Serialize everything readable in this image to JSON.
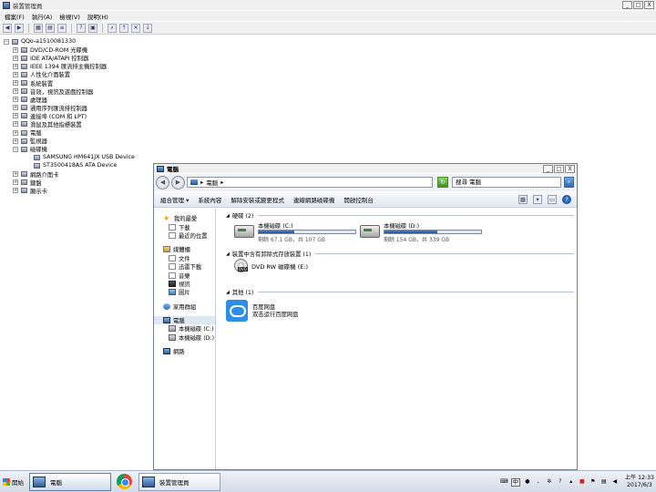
{
  "device_manager": {
    "title": "裝置管理員",
    "menu": [
      "檔案(F)",
      "執行(A)",
      "檢視(V)",
      "說明(H)"
    ],
    "tree": [
      {
        "label": "QQo-a1510081330",
        "level": 0,
        "exp": "−"
      },
      {
        "label": "DVD/CD-ROM 光碟機",
        "level": 1,
        "exp": "+"
      },
      {
        "label": "IDE ATA/ATAPI 控制器",
        "level": 1,
        "exp": "+"
      },
      {
        "label": "IEEE 1394 匯流排主機控制器",
        "level": 1,
        "exp": "+"
      },
      {
        "label": "人性化介面裝置",
        "level": 1,
        "exp": "+"
      },
      {
        "label": "系統裝置",
        "level": 1,
        "exp": "+"
      },
      {
        "label": "音效，視訊及遊戲控制器",
        "level": 1,
        "exp": "+"
      },
      {
        "label": "處理器",
        "level": 1,
        "exp": "+"
      },
      {
        "label": "通用序列匯流排控制器",
        "level": 1,
        "exp": "+"
      },
      {
        "label": "連接埠 (COM 和 LPT)",
        "level": 1,
        "exp": "+"
      },
      {
        "label": "滑鼠及其他指標裝置",
        "level": 1,
        "exp": "+"
      },
      {
        "label": "電腦",
        "level": 1,
        "exp": "+"
      },
      {
        "label": "監視器",
        "level": 1,
        "exp": "+"
      },
      {
        "label": "磁碟機",
        "level": 1,
        "exp": "−"
      },
      {
        "label": "SAMSUNG HM641JX USB Device",
        "level": 2,
        "exp": ""
      },
      {
        "label": "ST3500418AS ATA Device",
        "level": 2,
        "exp": ""
      },
      {
        "label": "網路介面卡",
        "level": 1,
        "exp": "+"
      },
      {
        "label": "鍵盤",
        "level": 1,
        "exp": "+"
      },
      {
        "label": "顯示卡",
        "level": 1,
        "exp": "+"
      }
    ]
  },
  "explorer": {
    "title": "電腦",
    "address": "電腦",
    "search_placeholder": "搜尋 電腦",
    "commands": [
      "組合管理 ▾",
      "系統內容",
      "解除安裝或變更程式",
      "連線網路磁碟機",
      "開啟控制台"
    ],
    "nav": {
      "favorites": "我的最愛",
      "downloads": "下載",
      "recent": "最近的位置",
      "libraries": "媒體櫃",
      "documents": "文件",
      "xunlei": "迅雷下載",
      "music": "音樂",
      "videos": "視訊",
      "pictures": "圖片",
      "homegroup": "家用群組",
      "computer": "電腦",
      "drive_c": "本機磁碟 (C:)",
      "drive_d": "本機磁碟 (D:)",
      "network": "網路"
    },
    "groups": {
      "hdd": "硬碟 (2)",
      "removable": "裝置中含有卸除式存放裝置 (1)",
      "other": "其他 (1)"
    },
    "drives": [
      {
        "name": "本機磁碟 (C:)",
        "free_text": "剩餘 67.1 GB，共 107 GB",
        "used_fraction": 0.37
      },
      {
        "name": "本機磁碟 (D:)",
        "free_text": "剩餘 154 GB，共 339 GB",
        "used_fraction": 0.55
      }
    ],
    "dvd": {
      "name": "DVD RW 磁碟機 (E:)",
      "tag": "DVD"
    },
    "baidu": {
      "name": "百度网盘",
      "desc": "双击运行百度网盘"
    }
  },
  "taskbar": {
    "start": "開始",
    "tasks": [
      "電腦",
      "裝置管理員"
    ],
    "ime": "中",
    "time": "上午 12:33",
    "date": "2017/6/3"
  },
  "window_buttons": {
    "min": "_",
    "max": "□",
    "close": "X"
  }
}
